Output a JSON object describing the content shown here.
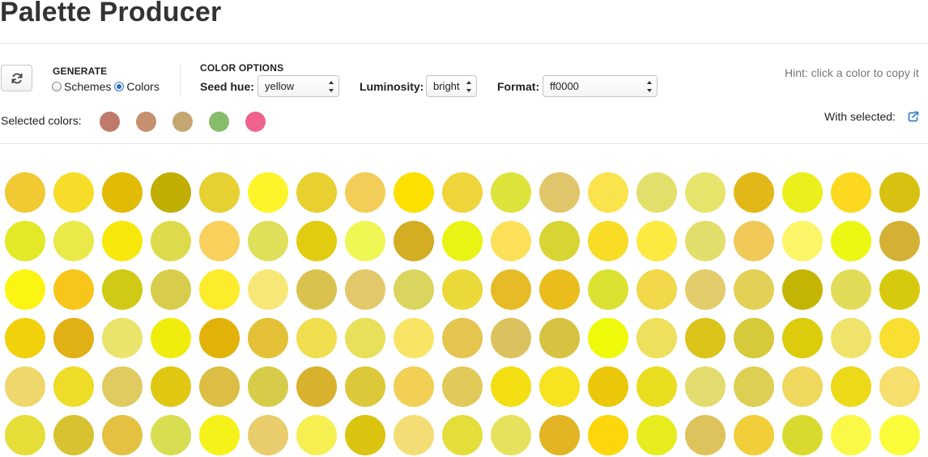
{
  "app": {
    "title": "Palette Producer"
  },
  "generate": {
    "heading": "GENERATE",
    "options": [
      {
        "label": "Schemes",
        "checked": false
      },
      {
        "label": "Colors",
        "checked": true
      }
    ]
  },
  "color_options": {
    "heading": "COLOR OPTIONS",
    "seed_hue": {
      "label": "Seed hue:",
      "value": "yellow"
    },
    "luminosity": {
      "label": "Luminosity:",
      "value": "bright"
    },
    "format": {
      "label": "Format:",
      "value": "ff0000"
    }
  },
  "hint": "Hint: click a color to copy it",
  "selected": {
    "label": "Selected colors:",
    "colors": [
      "#c07a6c",
      "#c49070",
      "#c4a670",
      "#86bc6a",
      "#ef628c"
    ]
  },
  "with_selected": {
    "label": "With selected:",
    "icon": "export-icon",
    "icon_color": "#3b86c9"
  },
  "palette": [
    [
      "#f0c933",
      "#f7dd29",
      "#e2bb06",
      "#c1ae03",
      "#e7d032",
      "#fdf52a",
      "#e7d02f",
      "#f2ce58",
      "#fbe000",
      "#f0d43c",
      "#dce33b",
      "#e1c56b",
      "#fbe34e",
      "#e2e06b",
      "#e7e46c",
      "#e2b818",
      "#ebf01c",
      "#fcd920",
      "#d7c211"
    ],
    [
      "#e3e827",
      "#e9ea49",
      "#f8e70b",
      "#dddb4b",
      "#f8d05b",
      "#dfe059",
      "#e2cc0f",
      "#eef753",
      "#d3ad22",
      "#e9f414",
      "#fde05a",
      "#d8d434",
      "#f8dc26",
      "#fde93f",
      "#e2de6b",
      "#f0c959",
      "#fbf568",
      "#ebf814",
      "#d4b135"
    ],
    [
      "#fcf514",
      "#f8c61a",
      "#d0c915",
      "#d8cc4c",
      "#fdec2c",
      "#f7e776",
      "#d9c34e",
      "#e2c86a",
      "#dad55f",
      "#ebd93a",
      "#e7bb27",
      "#eabd1c",
      "#dae131",
      "#f0d848",
      "#e2cc6b",
      "#e3d057",
      "#c4b503",
      "#e1dc58",
      "#d7ca0e"
    ],
    [
      "#f0d10b",
      "#e1b014",
      "#eae46c",
      "#f0ed0d",
      "#e2b208",
      "#e3c036",
      "#f1de4e",
      "#e8e05a",
      "#f9e466",
      "#e6c450",
      "#dcc25e",
      "#d8c242",
      "#eff90a",
      "#eedf5d",
      "#dcc319",
      "#d6ca3b",
      "#dccc0b",
      "#f0e36c",
      "#f8df32"
    ],
    [
      "#f0d76b",
      "#eedc26",
      "#dfcb60",
      "#e0c812",
      "#dbbe43",
      "#d7cc49",
      "#d8b12d",
      "#dcc838",
      "#f2cf55",
      "#e1ca5a",
      "#f3df12",
      "#f7e31f",
      "#ebc709",
      "#eadd1f",
      "#e2dc6f",
      "#dccf54",
      "#f0d85e",
      "#ecd917",
      "#f6df6c"
    ],
    [
      "#e5de38",
      "#d8c231",
      "#e4c140",
      "#d8de52",
      "#f5f21a",
      "#e9cc6b",
      "#f5ef52",
      "#dac40f",
      "#f5dd76",
      "#e4de3b",
      "#e6e25d",
      "#e2b424",
      "#fdd70c",
      "#e7ec1e",
      "#dec25c",
      "#f1ce3a",
      "#d9da2f",
      "#fbf948",
      "#fafc3a"
    ]
  ]
}
